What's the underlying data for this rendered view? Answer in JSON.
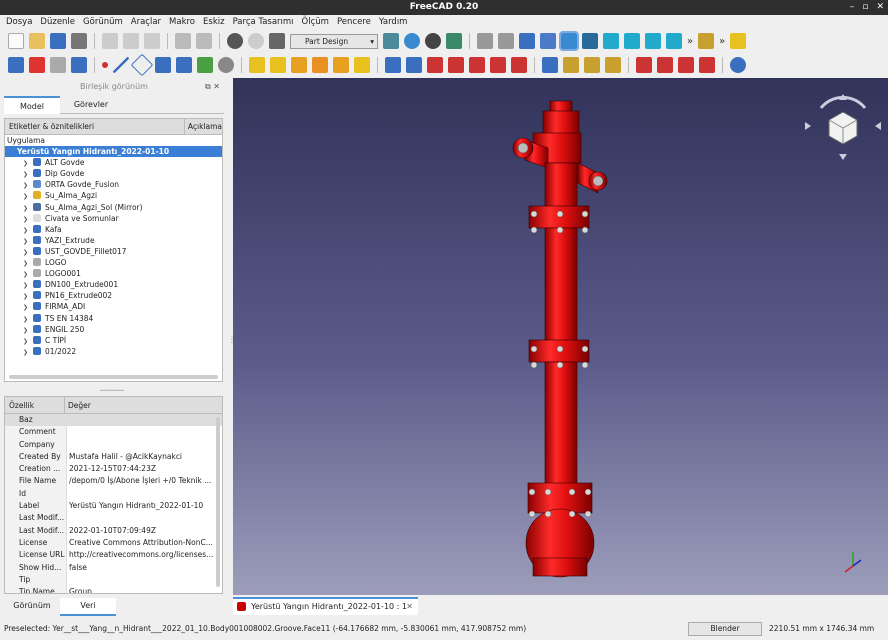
{
  "window": {
    "title": "FreeCAD 0.20",
    "controls": [
      "–",
      "▫",
      "✕"
    ]
  },
  "menu": [
    "Dosya",
    "Düzenle",
    "Görünüm",
    "Araçlar",
    "Makro",
    "Eskiz",
    "Parça Tasarımı",
    "Ölçüm",
    "Pencere",
    "Yardım"
  ],
  "toolbar": {
    "workbench": "Part Design",
    "more": "»"
  },
  "combo": {
    "title": "Birleşik görünüm",
    "tabs": [
      "Model",
      "Görevler"
    ]
  },
  "tree": {
    "col_labels": "Etiketler & öznitelikleri",
    "col_desc": "Açıklama",
    "app_label": "Uygulama",
    "root": "Yerüstü Yangın Hidrantı_2022-01-10",
    "items": [
      {
        "label": "ALT Govde",
        "icon": "body-icon"
      },
      {
        "label": "Dip Govde",
        "icon": "body-icon"
      },
      {
        "label": "ORTA Govde_Fusion",
        "icon": "fusion-icon"
      },
      {
        "label": "Su_Alma_Agzi",
        "icon": "part-icon"
      },
      {
        "label": "Su_Alma_Agzi_Sol (Mirror)",
        "icon": "mirror-icon"
      },
      {
        "label": "Civata ve Somunlar",
        "icon": "folder-icon"
      },
      {
        "label": "Kafa",
        "icon": "body-icon"
      },
      {
        "label": "YAZI_Extrude",
        "icon": "body-icon"
      },
      {
        "label": "UST_GOVDE_Fillet017",
        "icon": "fillet-icon"
      },
      {
        "label": "LOGO",
        "icon": "shape-icon"
      },
      {
        "label": "LOGO001",
        "icon": "shape-icon"
      },
      {
        "label": "DN100_Extrude001",
        "icon": "body-icon"
      },
      {
        "label": "PN16_Extrude002",
        "icon": "body-icon"
      },
      {
        "label": "FIRMA_ADI",
        "icon": "body-icon"
      },
      {
        "label": "TS EN 14384",
        "icon": "body-icon"
      },
      {
        "label": "ENGIL 250",
        "icon": "body-icon"
      },
      {
        "label": "C TİPİ",
        "icon": "body-icon"
      },
      {
        "label": "01/2022",
        "icon": "body-icon"
      }
    ]
  },
  "props": {
    "col_key": "Özellik",
    "col_val": "Değer",
    "group": "Baz",
    "rows": [
      {
        "k": "Comment",
        "v": ""
      },
      {
        "k": "Company",
        "v": ""
      },
      {
        "k": "Created By",
        "v": "Mustafa Halil - @AcikKaynakci"
      },
      {
        "k": "Creation ...",
        "v": "2021-12-15T07:44:23Z"
      },
      {
        "k": "File Name",
        "v": "/depom/0 İş/Abone İşleri +/0 Teknik ..."
      },
      {
        "k": "Id",
        "v": ""
      },
      {
        "k": "Label",
        "v": "Yerüstü Yangın Hidrantı_2022-01-10"
      },
      {
        "k": "Last Modif...",
        "v": ""
      },
      {
        "k": "Last Modif...",
        "v": "2022-01-10T07:09:49Z"
      },
      {
        "k": "License",
        "v": "Creative Commons Attribution-NonC..."
      },
      {
        "k": "License URL",
        "v": "http://creativecommons.org/licenses..."
      },
      {
        "k": "Show Hid...",
        "v": "false"
      },
      {
        "k": "Tip",
        "v": ""
      },
      {
        "k": "Tip Name",
        "v": "Group"
      }
    ]
  },
  "bottom_tabs": [
    "Görünüm",
    "Veri"
  ],
  "doc_tab": "Yerüstü Yangın Hidrantı_2022-01-10 : 1",
  "status": {
    "preselected": "Preselected: Yer__st___Yang__n_Hidrant___2022_01_10.Body001008002.Groove.Face11 (-64.176682 mm, -5.830061 mm, 417.908752 mm)",
    "nav_style": "Blender",
    "dims": "2210.51 mm x 1746.34 mm"
  },
  "colors": {
    "model": "#e8141b",
    "selection": "#3a7fd5",
    "viewport_top": "#32335a",
    "viewport_bottom": "#9d9dbb"
  }
}
